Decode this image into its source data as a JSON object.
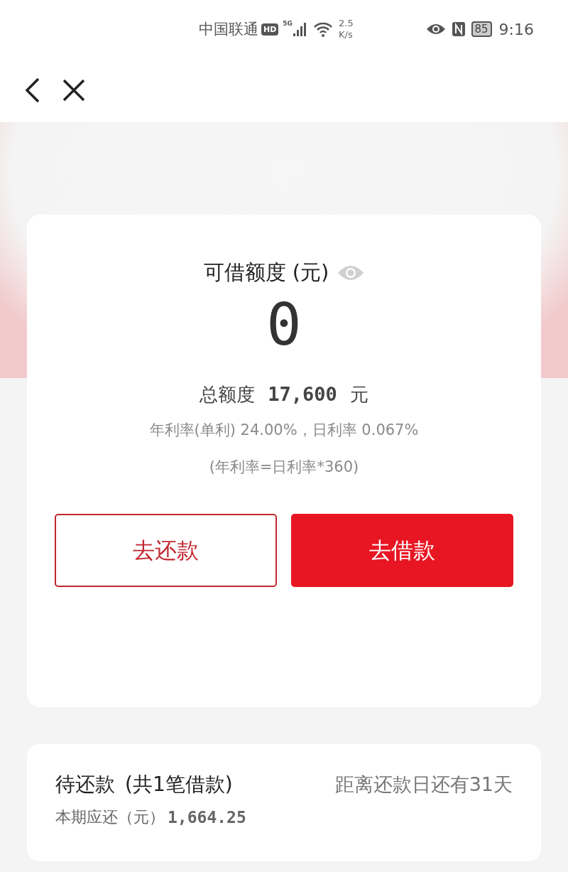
{
  "status_bar": {
    "carrier": "中国联通",
    "hd_badge": "HD",
    "network_type": "5G",
    "speed_value": "2.5",
    "speed_unit": "K/s",
    "battery": "85",
    "time": "9:16"
  },
  "credit_card": {
    "title": "可借额度 (元)",
    "amount": "0",
    "total_label": "总额度",
    "total_value": "17,600",
    "total_unit": "元",
    "rate_line": "年利率(单利) 24.00%，日利率 0.067%",
    "rate_note": "(年利率=日利率*360)",
    "buttons": [
      {
        "label": "去还款",
        "kind": "outline"
      },
      {
        "label": "去借款",
        "kind": "filled"
      }
    ]
  },
  "repayment_card": {
    "title": "待还款",
    "count": "(共1笔借款)",
    "days_left": "距离还款日还有31天",
    "due_label": "本期应还（元）",
    "due_value": "1,664.25"
  }
}
